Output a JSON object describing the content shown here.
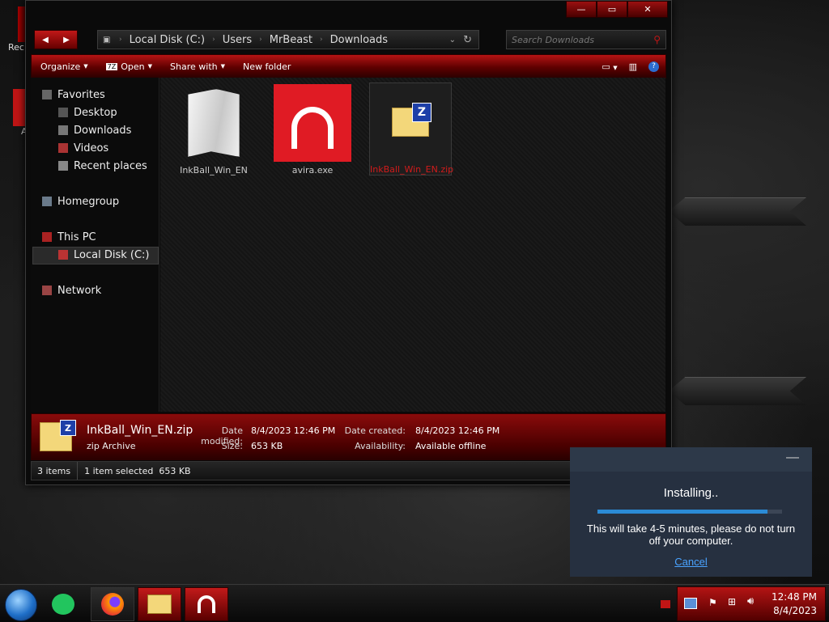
{
  "desktop": {
    "icons": [
      {
        "label": "Rec"
      },
      {
        "label": "A"
      }
    ]
  },
  "window": {
    "address": {
      "crumbs": [
        "Local Disk (C:)",
        "Users",
        "MrBeast",
        "Downloads"
      ]
    },
    "search": {
      "placeholder": "Search Downloads"
    },
    "toolbar": {
      "organize": "Organize",
      "open": "Open",
      "share_with": "Share with",
      "new_folder": "New folder"
    },
    "sidebar": {
      "favorites": "Favorites",
      "desktop": "Desktop",
      "downloads": "Downloads",
      "videos": "Videos",
      "recent_places": "Recent places",
      "homegroup": "Homegroup",
      "this_pc": "This PC",
      "local_disk": "Local Disk (C:)",
      "network": "Network"
    },
    "files": [
      {
        "name": "InkBall_Win_EN",
        "icon": "folder-icon"
      },
      {
        "name": "avira.exe",
        "icon": "avira-icon"
      },
      {
        "name": "InkBall_Win_EN.zip",
        "icon": "zip-folder-icon",
        "selected": true
      }
    ],
    "details": {
      "name": "InkBall_Win_EN.zip",
      "type": "zip Archive",
      "date_modified_label": "Date modified:",
      "date_modified": "8/4/2023 12:46 PM",
      "size_label": "Size:",
      "size": "653 KB",
      "date_created_label": "Date created:",
      "date_created": "8/4/2023 12:46 PM",
      "availability_label": "Availability:",
      "availability": "Available offline"
    },
    "status": {
      "items": "3 items",
      "selected": "1 item selected  653 KB"
    }
  },
  "notification": {
    "title": "Installing..",
    "progress": 0.92,
    "message": "This will take 4-5 minutes, please do not turn off your computer.",
    "cancel": "Cancel"
  },
  "taskbar": {
    "time": "12:48 PM",
    "date": "8/4/2023"
  },
  "colors": {
    "accent": "#b51414",
    "progress": "#2b8bd6",
    "link": "#4aa3ff"
  }
}
